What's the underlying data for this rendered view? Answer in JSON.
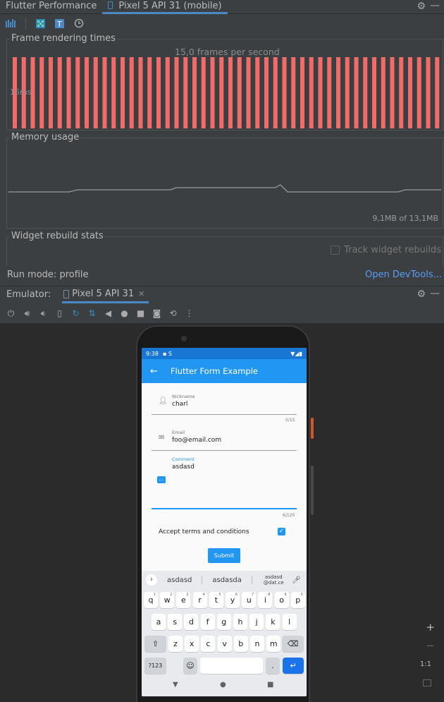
{
  "top_tabs": {
    "perf_label": "Flutter Performance",
    "device_label": "Pixel 5 API 31 (mobile)"
  },
  "frame_rendering": {
    "title": "Frame rendering times",
    "fps_text": "15,0 frames per second",
    "ms_label": "16ms",
    "bar_count": 48,
    "bar_color": "#f26b68"
  },
  "memory": {
    "title": "Memory usage",
    "footer": "9,1MB of 13,1MB"
  },
  "widget_rebuild": {
    "title": "Widget rebuild stats",
    "track_label": "Track widget rebuilds"
  },
  "run_mode": "Run mode: profile",
  "open_devtools": "Open DevTools...",
  "emulator": {
    "label": "Emulator:",
    "tab_label": "Pixel 5 API 31",
    "zoom_ratio": "1:1"
  },
  "phone": {
    "status_time": "9:38",
    "app_title": "Flutter Form Example",
    "nickname_label": "Nickname",
    "nickname_value": "charl",
    "nickname_counter": "5/15",
    "email_label": "Email",
    "email_value": "foo@email.com",
    "comment_label": "Comment",
    "comment_value": "asdasd",
    "comment_counter": "6/120",
    "accept_label": "Accept terms and conditions",
    "submit_label": "Submit",
    "suggestions": [
      "asdasd",
      "asdasda",
      "asdasd",
      "@dat.ce"
    ],
    "row1": [
      "q",
      "w",
      "e",
      "r",
      "t",
      "y",
      "u",
      "i",
      "o",
      "p"
    ],
    "row1_sup": [
      "1",
      "2",
      "3",
      "4",
      "5",
      "6",
      "7",
      "8",
      "9",
      "0"
    ],
    "row2": [
      "a",
      "s",
      "d",
      "f",
      "g",
      "h",
      "j",
      "k",
      "l"
    ],
    "row3": [
      "z",
      "x",
      "c",
      "v",
      "b",
      "n",
      "m"
    ],
    "sym_key": "?123",
    "period_key": "."
  }
}
